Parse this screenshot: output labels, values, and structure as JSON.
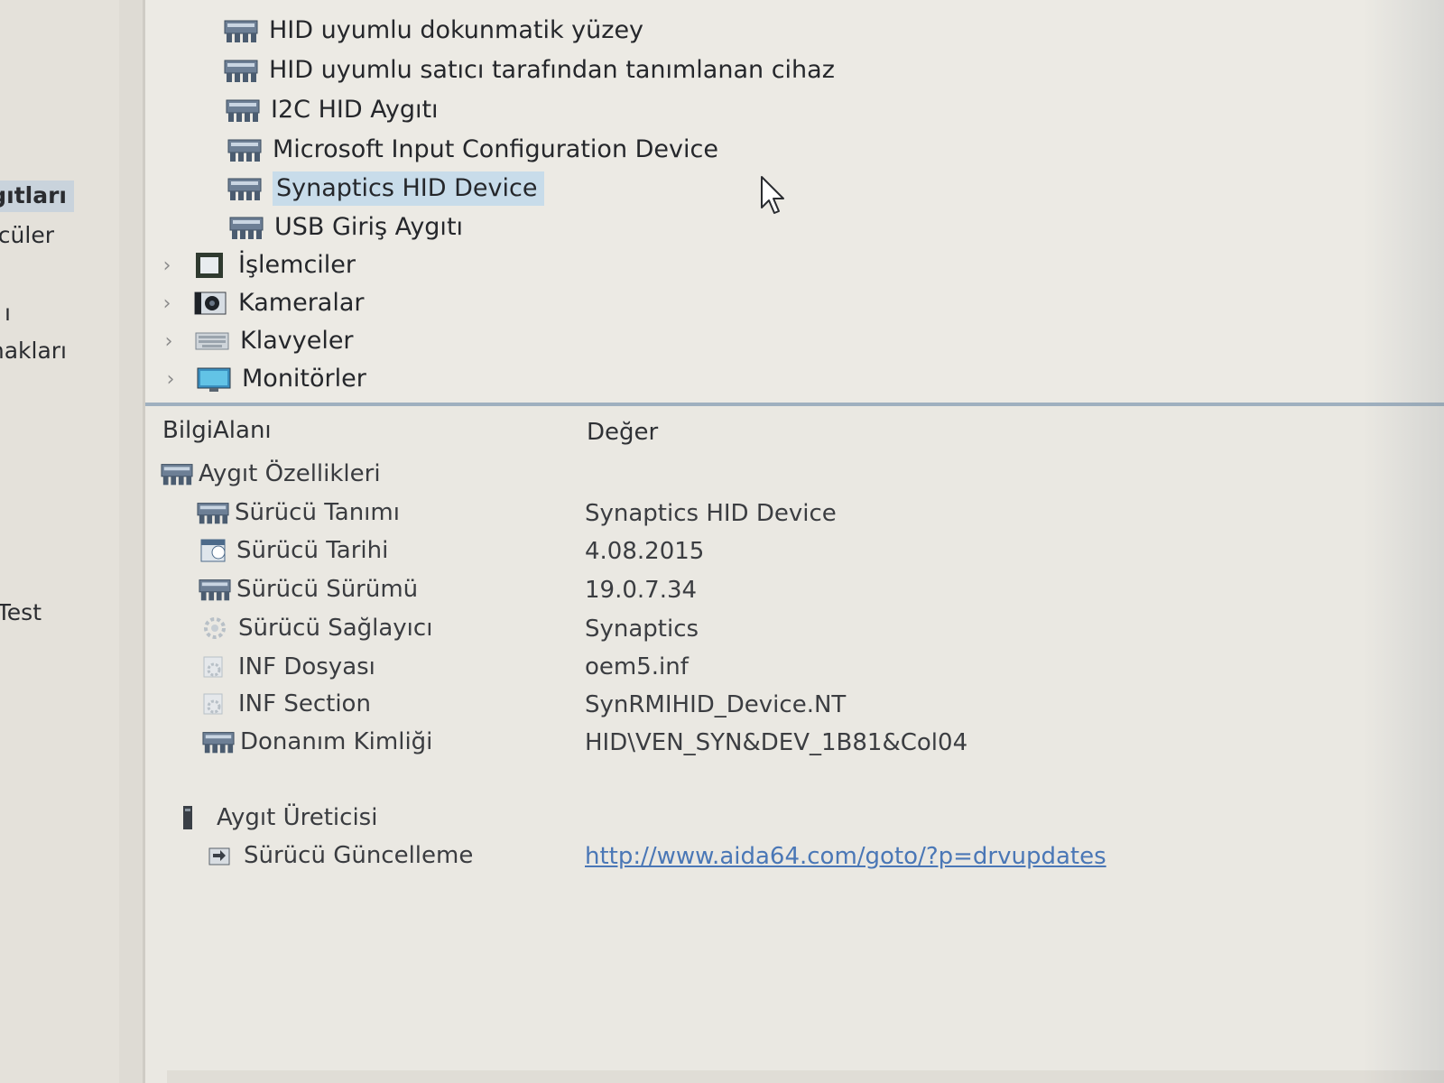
{
  "left_nav": {
    "items": [
      {
        "label": "gıtları",
        "selected": true
      },
      {
        "label": "cüler",
        "selected": false
      },
      {
        "label": "ı",
        "selected": false
      },
      {
        "label": "nakları",
        "selected": false
      },
      {
        "label": "Test",
        "selected": false
      }
    ]
  },
  "tree": {
    "hid_children": [
      {
        "label": "HID uyumlu dokunmatik yüzey",
        "selected": false
      },
      {
        "label": "HID uyumlu satıcı tarafından tanımlanan cihaz",
        "selected": false
      },
      {
        "label": "I2C HID Aygıtı",
        "selected": false
      },
      {
        "label": "Microsoft Input Configuration Device",
        "selected": false
      },
      {
        "label": "Synaptics HID Device",
        "selected": true
      },
      {
        "label": "USB Giriş Aygıtı",
        "selected": false
      }
    ],
    "categories": [
      {
        "label": "İşlemciler",
        "icon": "processor-icon",
        "expander": "›"
      },
      {
        "label": "Kameralar",
        "icon": "camera-icon",
        "expander": "›"
      },
      {
        "label": "Klavyeler",
        "icon": "keyboard-icon",
        "expander": "›"
      },
      {
        "label": "Monitörler",
        "icon": "monitor-icon",
        "expander": "›"
      }
    ]
  },
  "details": {
    "columns": {
      "field": "BilgiAlanı",
      "value": "Değer"
    },
    "section_device_properties": "Aygıt Özellikleri",
    "properties": [
      {
        "name": "Sürücü Tanımı",
        "value": "Synaptics HID Device",
        "icon": "hid-device-icon"
      },
      {
        "name": "Sürücü Tarihi",
        "value": "4.08.2015",
        "icon": "calendar-icon"
      },
      {
        "name": "Sürücü Sürümü",
        "value": "19.0.7.34",
        "icon": "hid-device-icon"
      },
      {
        "name": "Sürücü Sağlayıcı",
        "value": "Synaptics",
        "icon": "gear-icon"
      },
      {
        "name": "INF Dosyası",
        "value": "oem5.inf",
        "icon": "file-gear-icon"
      },
      {
        "name": "INF Section",
        "value": "SynRMIHID_Device.NT",
        "icon": "file-gear-icon"
      },
      {
        "name": "Donanım Kimliği",
        "value": "HID\\VEN_SYN&DEV_1B81&Col04",
        "icon": "hid-device-icon"
      }
    ],
    "section_manufacturer": "Aygıt Üreticisi",
    "driver_update": {
      "name": "Sürücü Güncelleme",
      "link": "http://www.aida64.com/goto/?p=drvupdates"
    }
  },
  "colors": {
    "selection": "#c8dcea",
    "link": "#4a77b6",
    "divider": "#9fb0bf"
  }
}
